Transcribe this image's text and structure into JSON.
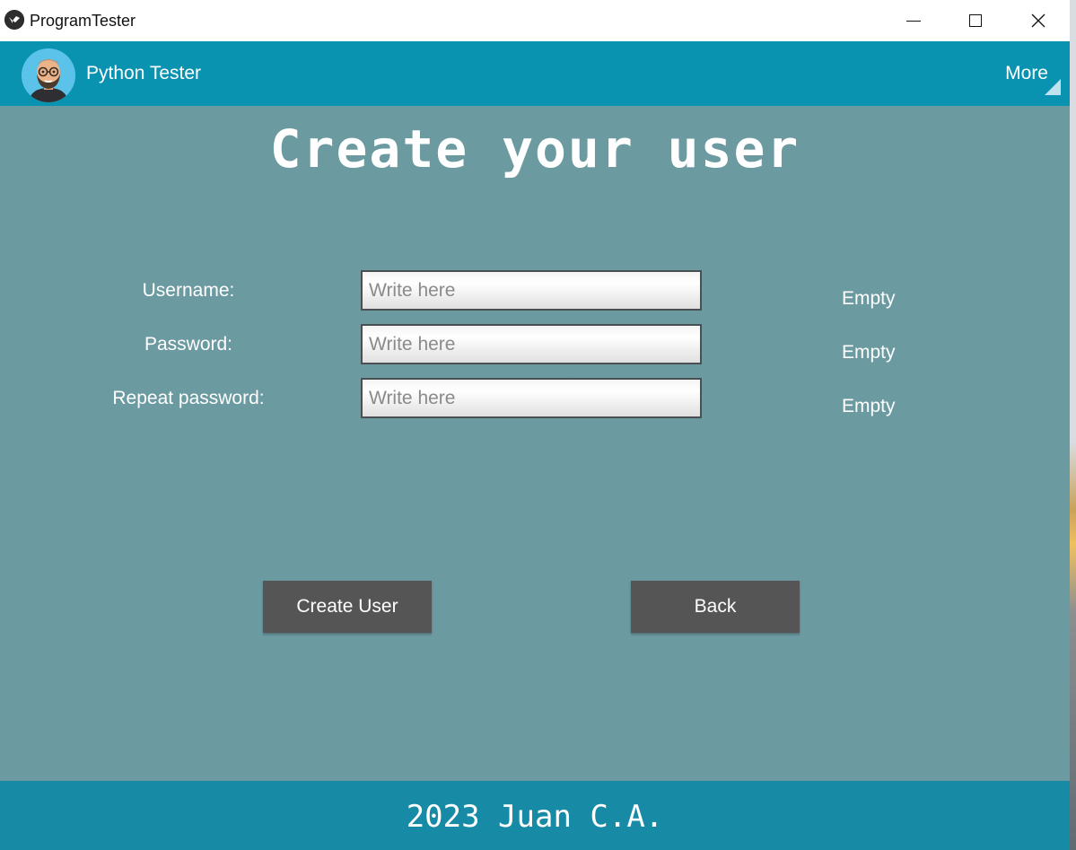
{
  "window": {
    "title": "ProgramTester",
    "app_icon": "kivy-logo-icon"
  },
  "appbar": {
    "title": "Python Tester",
    "avatar": "user-avatar",
    "more_label": "More",
    "color": "#0a93b1"
  },
  "main": {
    "heading": "Create your user",
    "background": "#6b9aa1",
    "fields": [
      {
        "label": "Username:",
        "placeholder": "Write here",
        "value": "",
        "status": "Empty"
      },
      {
        "label": "Password:",
        "placeholder": "Write here",
        "value": "",
        "status": "Empty"
      },
      {
        "label": "Repeat password:",
        "placeholder": "Write here",
        "value": "",
        "status": "Empty"
      }
    ],
    "buttons": {
      "create_label": "Create User",
      "back_label": "Back"
    }
  },
  "footer": {
    "text": "2023 Juan C.A.",
    "color": "#178aa6"
  }
}
